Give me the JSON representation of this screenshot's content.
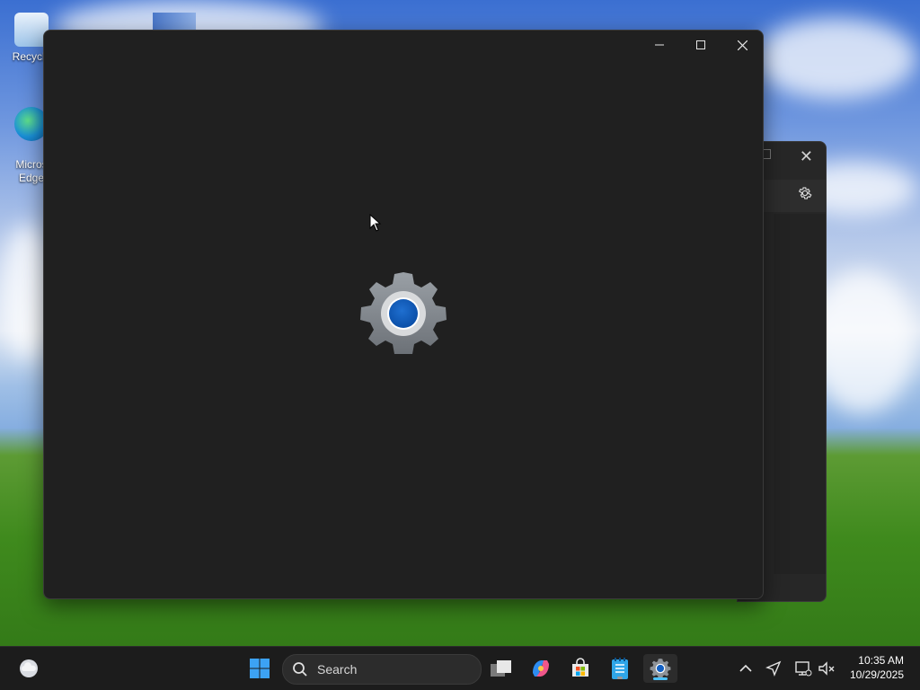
{
  "desktop": {
    "icons": [
      {
        "label": "Recycle"
      },
      {
        "label": "Micros\nEdge"
      }
    ]
  },
  "main_window": {
    "controls": {
      "minimize": "—",
      "maximize": "☐",
      "close": "✕"
    }
  },
  "back_window": {
    "close": "✕"
  },
  "taskbar": {
    "search": {
      "placeholder": "Search"
    },
    "clock": {
      "time": "10:35 AM",
      "date": "10/29/2025"
    }
  },
  "colors": {
    "accent": "#0067c0",
    "window_bg": "#202020",
    "taskbar_bg": "#1c1c1c",
    "active_indicator": "#4cc2ff"
  }
}
